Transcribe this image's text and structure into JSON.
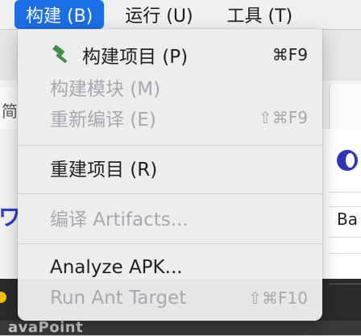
{
  "menubar": {
    "items": [
      {
        "label": "构建 (B)",
        "active": true
      },
      {
        "label": "运行 (U)",
        "active": false
      },
      {
        "label": "工具 (T)",
        "active": false
      }
    ]
  },
  "dropdown": {
    "items": [
      {
        "label": "构建项目 (P)",
        "shortcut": "⌘F9",
        "enabled": true,
        "icon": "hammer-icon"
      },
      {
        "label": "构建模块 (M)",
        "shortcut": "",
        "enabled": false
      },
      {
        "label": "重新编译 (E)",
        "shortcut": "⇧⌘F9",
        "enabled": false
      },
      {
        "label": "重建项目 (R)",
        "shortcut": "",
        "enabled": true
      },
      {
        "label": "编译 Artifacts...",
        "shortcut": "",
        "enabled": false
      },
      {
        "label": "Analyze APK...",
        "shortcut": "",
        "enabled": true
      },
      {
        "label": "Run Ant Target",
        "shortcut": "⇧⌘F10",
        "enabled": false
      }
    ]
  },
  "background": {
    "left_tab_text": "简",
    "right_panel_text": "Ba",
    "left_page_text": "ワ",
    "bottom_text": "avaPoint"
  },
  "colors": {
    "accent": "#1a6fe6",
    "hammer": "#3f9142",
    "disabled_text": "#a9a9ad"
  }
}
